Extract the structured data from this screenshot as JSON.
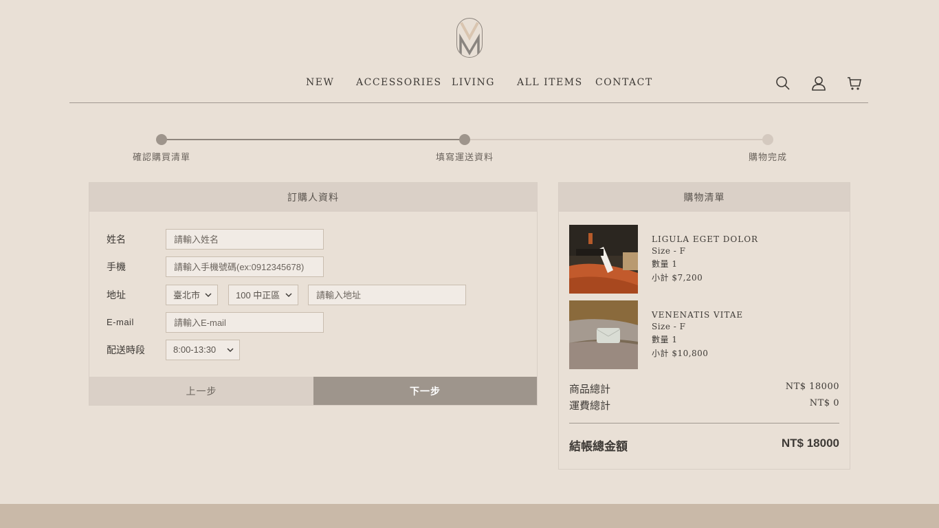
{
  "nav": {
    "items": [
      "NEW",
      "ACCESSORIES",
      "LIVING",
      "ALL ITEMS",
      "CONTACT"
    ],
    "icons": [
      "search-icon",
      "user-icon",
      "cart-icon"
    ]
  },
  "progress": {
    "steps": [
      "確認購買清單",
      "填寫運送資料",
      "購物完成"
    ]
  },
  "form": {
    "title": "訂購人資料",
    "name_label": "姓名",
    "name_placeholder": "請輸入姓名",
    "phone_label": "手機",
    "phone_placeholder": "請輸入手機號碼(ex:0912345678)",
    "address_label": "地址",
    "city_value": "臺北市",
    "district_value": "100 中正區",
    "address_placeholder": "請輸入地址",
    "email_label": "E-mail",
    "email_placeholder": "請輸入E-mail",
    "delivery_label": "配送時段",
    "delivery_value": "8:00-13:30",
    "prev_label": "上一步",
    "next_label": "下一步"
  },
  "cart": {
    "title": "購物清單",
    "items": [
      {
        "name": "LIGULA EGET DOLOR",
        "size": "Size - F",
        "qty": "數量 1",
        "subtotal": "小計 $7,200"
      },
      {
        "name": "VENENATIS VITAE",
        "size": "Size - F",
        "qty": "數量 1",
        "subtotal": "小計 $10,800"
      }
    ],
    "goods_total_label": "商品總計",
    "goods_total_value": "NT$ 18000",
    "shipping_label": "運費總計",
    "shipping_value": "NT$ 0",
    "grand_total_label": "結帳總金額",
    "grand_total_value": "NT$ 18000"
  },
  "colors": {
    "background": "#e9e0d6",
    "panel_header": "#dad0c7",
    "accent": "#9e958c",
    "footer": "#c9b9a8"
  }
}
